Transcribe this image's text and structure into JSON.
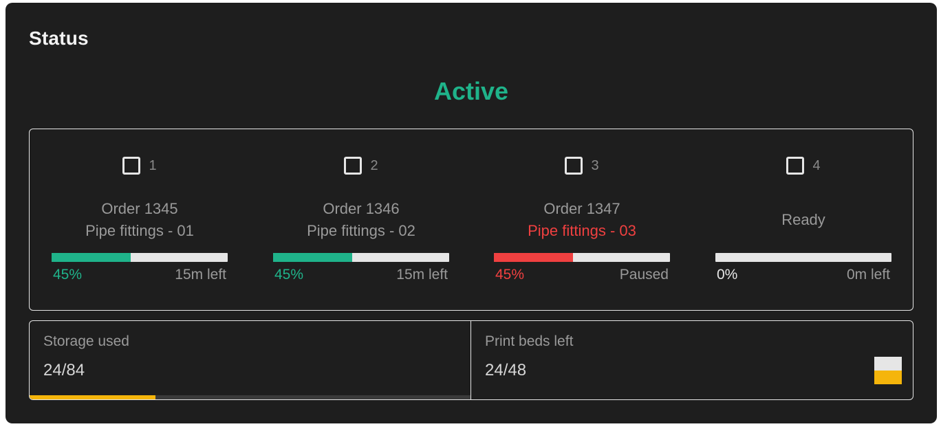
{
  "panel": {
    "title": "Status",
    "status": "Active",
    "status_color": "#1fb38a"
  },
  "printers": [
    {
      "number": "1",
      "icon": "printer-icon",
      "order": "Order 1345",
      "part": "Pipe fittings - 01",
      "progress_percent": 45,
      "progress_label": "45%",
      "remaining": "15m left",
      "color": "#1fb38a",
      "part_error": false
    },
    {
      "number": "2",
      "icon": "printer-icon",
      "order": "Order 1346",
      "part": "Pipe fittings - 02",
      "progress_percent": 45,
      "progress_label": "45%",
      "remaining": "15m left",
      "color": "#1fb38a",
      "part_error": false
    },
    {
      "number": "3",
      "icon": "printer-icon",
      "order": "Order 1347",
      "part": "Pipe fittings - 03",
      "progress_percent": 45,
      "progress_label": "45%",
      "remaining": "Paused",
      "color": "#f04040",
      "part_error": true
    },
    {
      "number": "4",
      "icon": "printer-icon",
      "state": "Ready",
      "progress_percent": 0,
      "progress_label": "0%",
      "remaining": "0m left",
      "color": "#e6e6e6",
      "part_error": false
    }
  ],
  "storage": {
    "label": "Storage used",
    "value": "24/84",
    "used_fraction": 0.2857,
    "color": "#f5b50b"
  },
  "print_beds": {
    "label": "Print beds left",
    "value": "24/48",
    "left_fraction": 0.5,
    "color": "#f5b50b"
  }
}
